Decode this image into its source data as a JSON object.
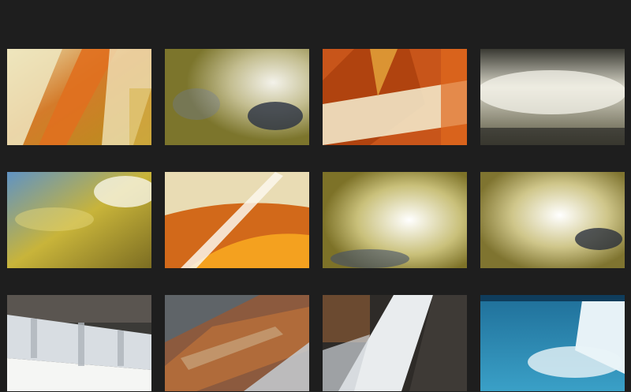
{
  "gallery": {
    "thumbnails": [
      {
        "subject": "orange-water-blur"
      },
      {
        "subject": "splashing-water-olive"
      },
      {
        "subject": "orange-water-chute"
      },
      {
        "subject": "white-water-spray-dark"
      },
      {
        "subject": "blue-gold-water-splash"
      },
      {
        "subject": "water-stream-orange-bowl"
      },
      {
        "subject": "white-splash-olive"
      },
      {
        "subject": "white-splash-olive-2"
      },
      {
        "subject": "cascade-over-rock-ledge"
      },
      {
        "subject": "water-over-red-rock"
      },
      {
        "subject": "waterfall-dark-rocks"
      },
      {
        "subject": "turquoise-pool-falls"
      }
    ]
  },
  "colors": {
    "background": "#1e1e1e",
    "accent_orange": "#d9661a",
    "olive": "#8a7f2e",
    "water_white": "#f2f1e6",
    "turquoise": "#2f8fb5"
  }
}
